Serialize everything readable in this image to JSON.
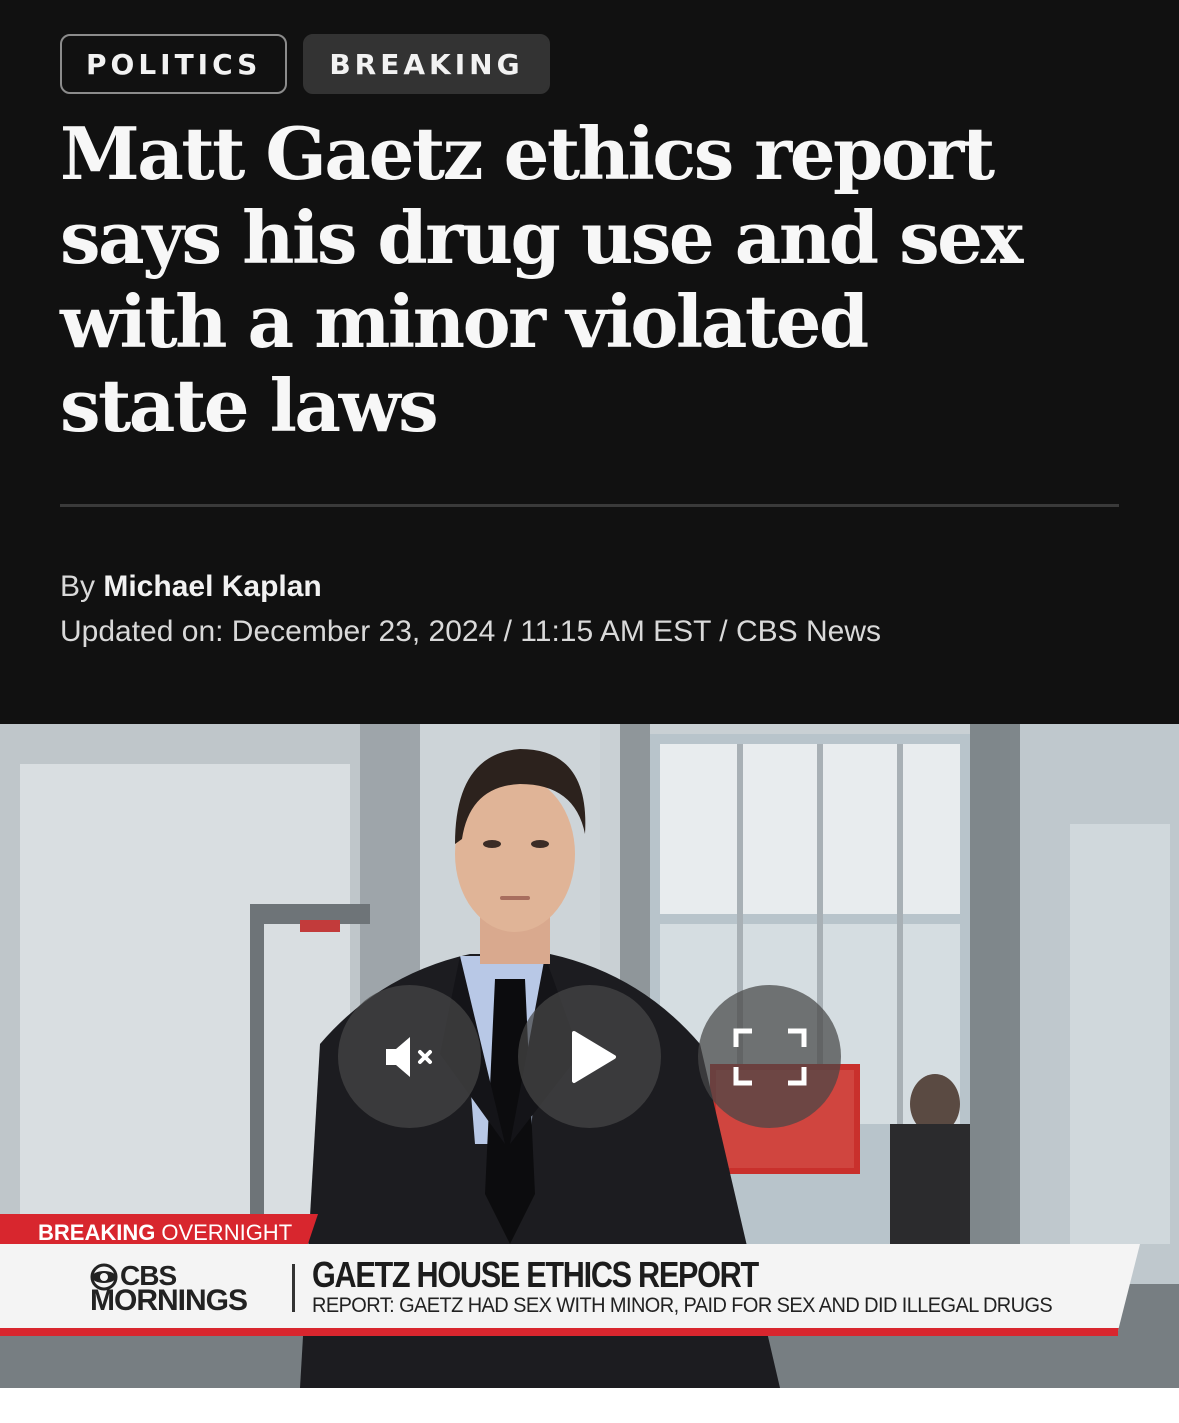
{
  "article": {
    "tags": [
      {
        "label": "POLITICS"
      },
      {
        "label": "BREAKING"
      }
    ],
    "headline": "Matt Gaetz ethics report says his drug use and sex with a minor violated state laws",
    "byline_prefix": "By",
    "author": "Michael Kaplan",
    "updated": "Updated on: December 23, 2024 / 11:15 AM EST / CBS News"
  },
  "video": {
    "controls": {
      "mute_icon": "speaker-muted-icon",
      "play_icon": "play-icon",
      "fullscreen_icon": "fullscreen-icon"
    },
    "lower_third": {
      "tag_strong": "BREAKING",
      "tag_rest": "OVERNIGHT",
      "logo_line1": "CBS",
      "logo_line2": "MORNINGS",
      "title": "GAETZ HOUSE ETHICS REPORT",
      "subtitle": "REPORT: GAETZ HAD SEX WITH MINOR, PAID FOR SEX AND DID ILLEGAL DRUGS"
    },
    "colors": {
      "accent_red": "#d8262e",
      "header_bg": "#111111"
    }
  }
}
